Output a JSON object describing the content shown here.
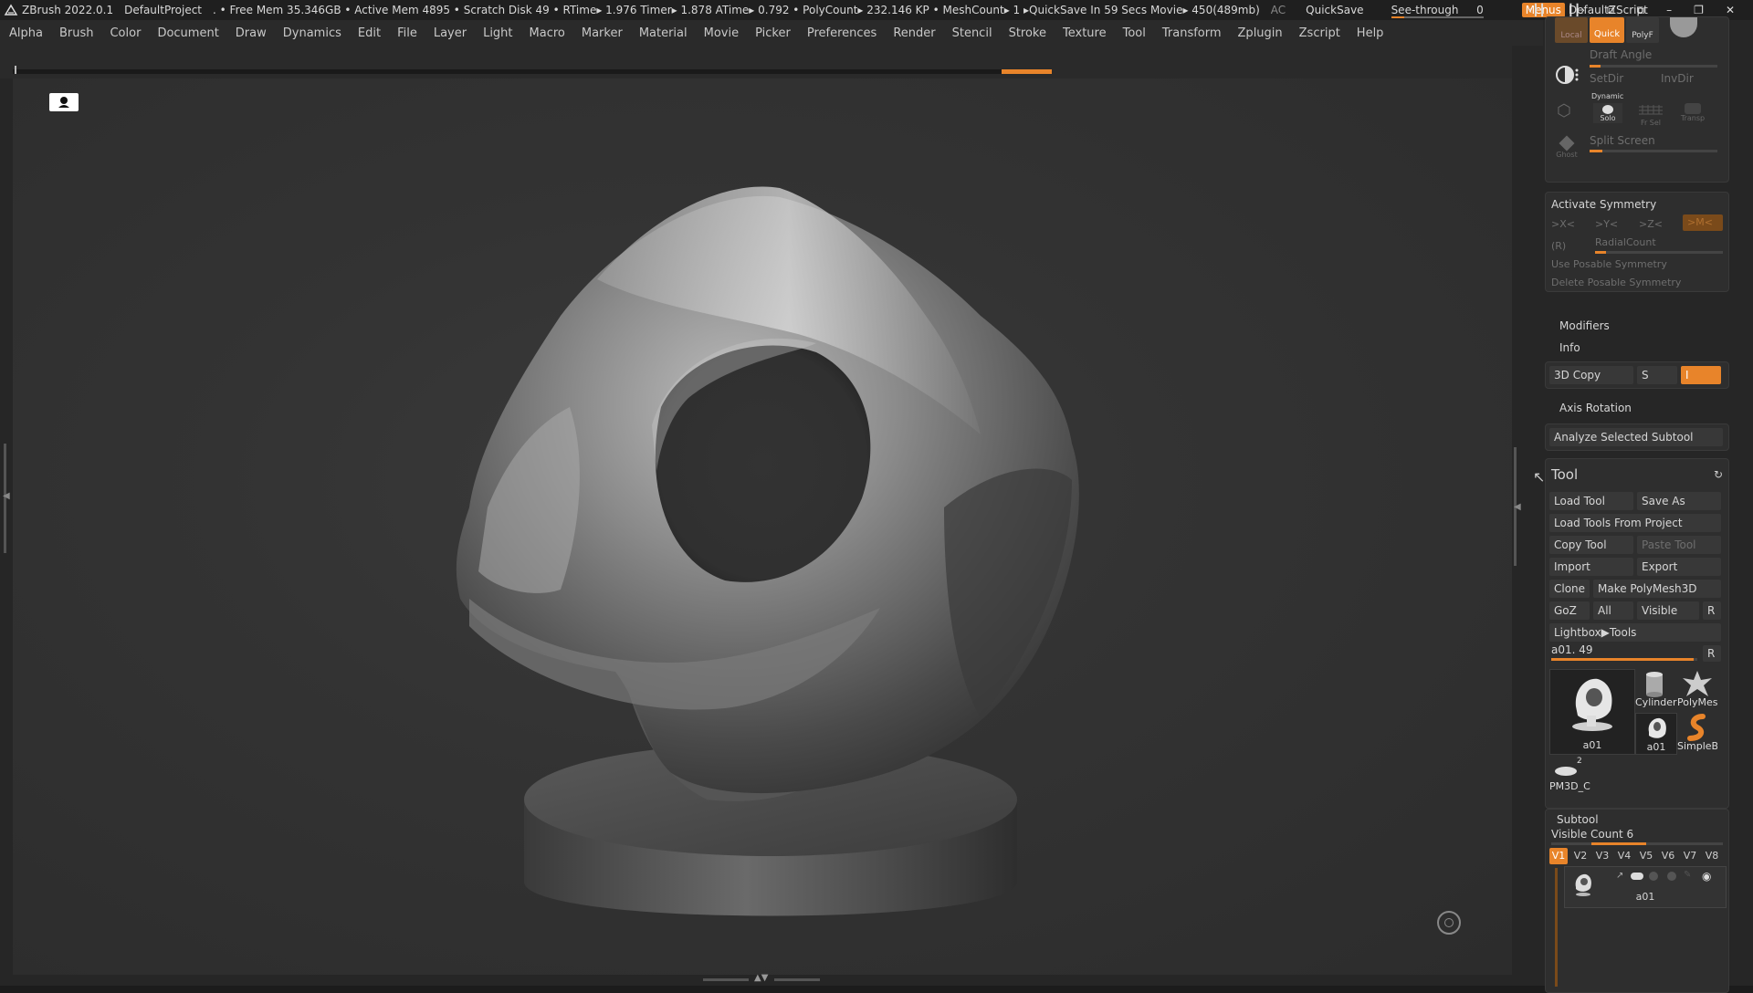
{
  "titlebar": {
    "app": "ZBrush 2022.0.1",
    "project": "DefaultProject",
    "stats": ". • Free Mem 35.346GB • Active Mem 4895 • Scratch Disk 49 • RTime▸ 1.976 Timer▸ 1.878 ATime▸ 0.792 • PolyCount▸ 232.146 KP • MeshCount▸ 1 ▸QuickSave In 59 Secs Movie▸ 450(489mb)",
    "ac": "AC",
    "quicksave": "QuickSave",
    "see_through_label": "See-through",
    "see_through_value": "0",
    "menus": "Menus",
    "zscript": "DefaultZScript"
  },
  "menubar": [
    "Alpha",
    "Brush",
    "Color",
    "Document",
    "Draw",
    "Dynamics",
    "Edit",
    "File",
    "Layer",
    "Light",
    "Macro",
    "Marker",
    "Material",
    "Movie",
    "Picker",
    "Preferences",
    "Render",
    "Stencil",
    "Stroke",
    "Texture",
    "Tool",
    "Transform",
    "Zplugin",
    "Zscript",
    "Help"
  ],
  "panel": {
    "top": {
      "local": "Local",
      "quick": "Quick",
      "polyf": "PolyF",
      "draft_angle": "Draft Angle",
      "setdir": "SetDir",
      "invdir": "InvDir",
      "dynamic": "Dynamic",
      "solo": "Solo",
      "frsel": "Fr Sel",
      "transp": "Transp",
      "split_screen": "Split Screen",
      "ghost": "Ghost"
    },
    "symmetry": {
      "activate": "Activate Symmetry",
      "x": ">X<",
      "y": ">Y<",
      "z": ">Z<",
      "m": ">M<",
      "r": "(R)",
      "radial_count": "RadialCount",
      "use_posable": "Use Posable Symmetry",
      "delete_posable": "Delete Posable Symmetry"
    },
    "modifiers": "Modifiers",
    "info": "Info",
    "copy3d": "3D Copy",
    "copy_s": "S",
    "copy_i": "I",
    "axis_rotation": "Axis Rotation",
    "analyze": "Analyze Selected Subtool",
    "tool": {
      "title": "Tool",
      "load_tool": "Load Tool",
      "save_as": "Save As",
      "load_from_project": "Load Tools From Project",
      "copy_tool": "Copy Tool",
      "paste_tool": "Paste Tool",
      "import": "Import",
      "export": "Export",
      "clone": "Clone",
      "make_polymesh": "Make PolyMesh3D",
      "goz": "GoZ",
      "all": "All",
      "visible": "Visible",
      "r": "R",
      "lightbox": "Lightbox▶Tools",
      "current": "a01. 49",
      "current_r": "R",
      "thumbs": [
        "a01",
        "Cylinder",
        "PolyMes",
        "a01",
        "SimpleB",
        "PM3D_C"
      ],
      "pm3d_badge": "2"
    },
    "subtool": {
      "title": "Subtool",
      "visible_count": "Visible Count 6",
      "tabs": [
        "V1",
        "V2",
        "V3",
        "V4",
        "V5",
        "V6",
        "V7",
        "V8"
      ],
      "item": "a01"
    }
  },
  "colors": {
    "accent": "#e8842a",
    "bg": "#262626",
    "viewport": "#333333"
  }
}
